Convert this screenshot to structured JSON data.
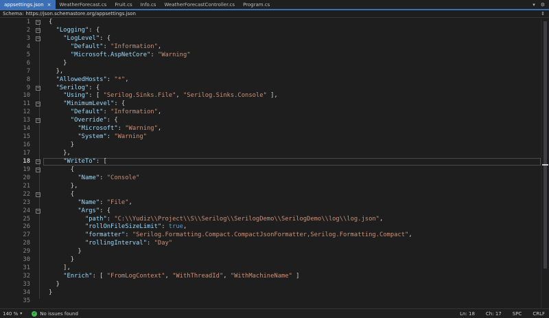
{
  "tabs": [
    {
      "name": "appsettings.json",
      "active": true,
      "has_close": true
    },
    {
      "name": "WeatherForecast.cs",
      "active": false,
      "has_close": false
    },
    {
      "name": "Fruit.cs",
      "active": false,
      "has_close": false
    },
    {
      "name": "Info.cs",
      "active": false,
      "has_close": false
    },
    {
      "name": "WeatherForecastController.cs",
      "active": false,
      "has_close": false
    },
    {
      "name": "Program.cs",
      "active": false,
      "has_close": false
    }
  ],
  "tab_close_glyph": "×",
  "tabbar_right": {
    "dropdown_glyph": "▾",
    "settings_glyph": "⚙"
  },
  "schema": {
    "label": "Schema:",
    "url": "https://json.schemastore.org/appsettings.json"
  },
  "expand_glyph": "⇕",
  "editor": {
    "current_line": 18,
    "lines": [
      {
        "n": "1",
        "fold": "−",
        "tokens": [
          {
            "t": "p",
            "v": "{"
          }
        ]
      },
      {
        "n": "2",
        "fold": "−",
        "tokens": [
          {
            "t": "p",
            "v": "  "
          },
          {
            "t": "k",
            "v": "\"Logging\""
          },
          {
            "t": "p",
            "v": ": {"
          }
        ]
      },
      {
        "n": "3",
        "fold": "−",
        "tokens": [
          {
            "t": "p",
            "v": "    "
          },
          {
            "t": "k",
            "v": "\"LogLevel\""
          },
          {
            "t": "p",
            "v": ": {"
          }
        ]
      },
      {
        "n": "4",
        "fold": "",
        "tokens": [
          {
            "t": "p",
            "v": "      "
          },
          {
            "t": "k",
            "v": "\"Default\""
          },
          {
            "t": "p",
            "v": ": "
          },
          {
            "t": "s",
            "v": "\"Information\""
          },
          {
            "t": "p",
            "v": ","
          }
        ]
      },
      {
        "n": "5",
        "fold": "",
        "tokens": [
          {
            "t": "p",
            "v": "      "
          },
          {
            "t": "k",
            "v": "\"Microsoft.AspNetCore\""
          },
          {
            "t": "p",
            "v": ": "
          },
          {
            "t": "s",
            "v": "\"Warning\""
          }
        ]
      },
      {
        "n": "6",
        "fold": "",
        "tokens": [
          {
            "t": "p",
            "v": "    }"
          }
        ]
      },
      {
        "n": "7",
        "fold": "",
        "tokens": [
          {
            "t": "p",
            "v": "  },"
          }
        ]
      },
      {
        "n": "8",
        "fold": "",
        "tokens": [
          {
            "t": "p",
            "v": "  "
          },
          {
            "t": "k",
            "v": "\"AllowedHosts\""
          },
          {
            "t": "p",
            "v": ": "
          },
          {
            "t": "s",
            "v": "\"*\""
          },
          {
            "t": "p",
            "v": ","
          }
        ]
      },
      {
        "n": "9",
        "fold": "−",
        "tokens": [
          {
            "t": "p",
            "v": "  "
          },
          {
            "t": "k",
            "v": "\"Serilog\""
          },
          {
            "t": "p",
            "v": ": {"
          }
        ]
      },
      {
        "n": "10",
        "fold": "",
        "tokens": [
          {
            "t": "p",
            "v": "    "
          },
          {
            "t": "k",
            "v": "\"Using\""
          },
          {
            "t": "p",
            "v": ": [ "
          },
          {
            "t": "s",
            "v": "\"Serilog.Sinks.File\""
          },
          {
            "t": "p",
            "v": ", "
          },
          {
            "t": "s",
            "v": "\"Serilog.Sinks.Console\""
          },
          {
            "t": "p",
            "v": " ],"
          }
        ]
      },
      {
        "n": "11",
        "fold": "−",
        "tokens": [
          {
            "t": "p",
            "v": "    "
          },
          {
            "t": "k",
            "v": "\"MinimumLevel\""
          },
          {
            "t": "p",
            "v": ": {"
          }
        ]
      },
      {
        "n": "12",
        "fold": "",
        "tokens": [
          {
            "t": "p",
            "v": "      "
          },
          {
            "t": "k",
            "v": "\"Default\""
          },
          {
            "t": "p",
            "v": ": "
          },
          {
            "t": "s",
            "v": "\"Information\""
          },
          {
            "t": "p",
            "v": ","
          }
        ]
      },
      {
        "n": "13",
        "fold": "−",
        "tokens": [
          {
            "t": "p",
            "v": "      "
          },
          {
            "t": "k",
            "v": "\"Override\""
          },
          {
            "t": "p",
            "v": ": {"
          }
        ]
      },
      {
        "n": "14",
        "fold": "",
        "tokens": [
          {
            "t": "p",
            "v": "        "
          },
          {
            "t": "k",
            "v": "\"Microsoft\""
          },
          {
            "t": "p",
            "v": ": "
          },
          {
            "t": "s",
            "v": "\"Warning\""
          },
          {
            "t": "p",
            "v": ","
          }
        ]
      },
      {
        "n": "15",
        "fold": "",
        "tokens": [
          {
            "t": "p",
            "v": "        "
          },
          {
            "t": "k",
            "v": "\"System\""
          },
          {
            "t": "p",
            "v": ": "
          },
          {
            "t": "s",
            "v": "\"Warning\""
          }
        ]
      },
      {
        "n": "16",
        "fold": "",
        "tokens": [
          {
            "t": "p",
            "v": "      }"
          }
        ]
      },
      {
        "n": "17",
        "fold": "",
        "tokens": [
          {
            "t": "p",
            "v": "    },"
          }
        ]
      },
      {
        "n": "18",
        "fold": "−",
        "tokens": [
          {
            "t": "p",
            "v": "    "
          },
          {
            "t": "k",
            "v": "\"WriteTo\""
          },
          {
            "t": "p",
            "v": ": ["
          }
        ]
      },
      {
        "n": "19",
        "fold": "−",
        "tokens": [
          {
            "t": "p",
            "v": "      {"
          }
        ]
      },
      {
        "n": "20",
        "fold": "",
        "tokens": [
          {
            "t": "p",
            "v": "        "
          },
          {
            "t": "k",
            "v": "\"Name\""
          },
          {
            "t": "p",
            "v": ": "
          },
          {
            "t": "s",
            "v": "\"Console\""
          }
        ]
      },
      {
        "n": "21",
        "fold": "",
        "tokens": [
          {
            "t": "p",
            "v": "      },"
          }
        ]
      },
      {
        "n": "22",
        "fold": "−",
        "tokens": [
          {
            "t": "p",
            "v": "      {"
          }
        ]
      },
      {
        "n": "23",
        "fold": "",
        "tokens": [
          {
            "t": "p",
            "v": "        "
          },
          {
            "t": "k",
            "v": "\"Name\""
          },
          {
            "t": "p",
            "v": ": "
          },
          {
            "t": "s",
            "v": "\"File\""
          },
          {
            "t": "p",
            "v": ","
          }
        ]
      },
      {
        "n": "24",
        "fold": "−",
        "tokens": [
          {
            "t": "p",
            "v": "        "
          },
          {
            "t": "k",
            "v": "\"Args\""
          },
          {
            "t": "p",
            "v": ": {"
          }
        ]
      },
      {
        "n": "25",
        "fold": "",
        "tokens": [
          {
            "t": "p",
            "v": "          "
          },
          {
            "t": "k",
            "v": "\"path\""
          },
          {
            "t": "p",
            "v": ": "
          },
          {
            "t": "s",
            "v": "\"C:\\\\Yudiz\\\\Project\\\\S\\\\Serilog\\\\SerilogDemo\\\\SerilogDemo\\\\log\\\\log.json\""
          },
          {
            "t": "p",
            "v": ","
          }
        ]
      },
      {
        "n": "26",
        "fold": "",
        "tokens": [
          {
            "t": "p",
            "v": "          "
          },
          {
            "t": "k",
            "v": "\"rollOnFileSizeLimit\""
          },
          {
            "t": "p",
            "v": ": "
          },
          {
            "t": "b",
            "v": "true"
          },
          {
            "t": "p",
            "v": ","
          }
        ]
      },
      {
        "n": "27",
        "fold": "",
        "tokens": [
          {
            "t": "p",
            "v": "          "
          },
          {
            "t": "k",
            "v": "\"formatter\""
          },
          {
            "t": "p",
            "v": ": "
          },
          {
            "t": "s",
            "v": "\"Serilog.Formatting.Compact.CompactJsonFormatter,Serilog.Formatting.Compact\""
          },
          {
            "t": "p",
            "v": ","
          }
        ]
      },
      {
        "n": "28",
        "fold": "",
        "tokens": [
          {
            "t": "p",
            "v": "          "
          },
          {
            "t": "k",
            "v": "\"rollingInterval\""
          },
          {
            "t": "p",
            "v": ": "
          },
          {
            "t": "s",
            "v": "\"Day\""
          }
        ]
      },
      {
        "n": "29",
        "fold": "",
        "tokens": [
          {
            "t": "p",
            "v": "        }"
          }
        ]
      },
      {
        "n": "30",
        "fold": "",
        "tokens": [
          {
            "t": "p",
            "v": "      }"
          }
        ]
      },
      {
        "n": "31",
        "fold": "",
        "tokens": [
          {
            "t": "p",
            "v": "    ],"
          }
        ]
      },
      {
        "n": "32",
        "fold": "",
        "tokens": [
          {
            "t": "p",
            "v": "    "
          },
          {
            "t": "k",
            "v": "\"Enrich\""
          },
          {
            "t": "p",
            "v": ": [ "
          },
          {
            "t": "s",
            "v": "\"FromLogContext\""
          },
          {
            "t": "p",
            "v": ", "
          },
          {
            "t": "s",
            "v": "\"WithThreadId\""
          },
          {
            "t": "p",
            "v": ", "
          },
          {
            "t": "s",
            "v": "\"WithMachineName\""
          },
          {
            "t": "p",
            "v": " ]"
          }
        ]
      },
      {
        "n": "33",
        "fold": "",
        "tokens": [
          {
            "t": "p",
            "v": "  }"
          }
        ]
      },
      {
        "n": "34",
        "fold": "",
        "tokens": [
          {
            "t": "p",
            "v": "}"
          }
        ]
      },
      {
        "n": "35",
        "fold": "",
        "tokens": []
      }
    ]
  },
  "status": {
    "zoom": "140 %",
    "zoom_arrow": "▾",
    "issues_check": "✓",
    "issues": "No issues found",
    "line": "Ln: 18",
    "col": "Ch: 17",
    "indent": "SPC",
    "eol": "CRLF"
  },
  "colors": {
    "accent": "#3b6fb6",
    "key": "#9cdcfe",
    "string": "#ce9178",
    "keyword": "#569cd6",
    "ok": "#3fb950"
  }
}
